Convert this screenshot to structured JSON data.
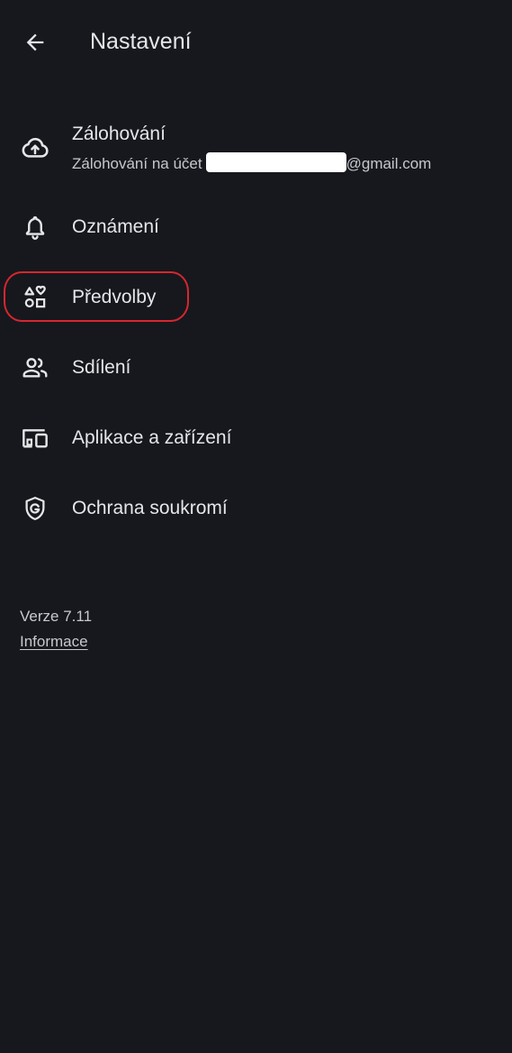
{
  "header": {
    "title": "Nastavení",
    "back_icon": "arrow-back-icon"
  },
  "menu": {
    "items": [
      {
        "id": "backup",
        "label": "Zálohování",
        "subtitle_prefix": "Zálohování na účet",
        "subtitle_suffix": "@gmail.com",
        "icon": "cloud-upload-icon"
      },
      {
        "id": "notifications",
        "label": "Oznámení",
        "icon": "bell-icon"
      },
      {
        "id": "preferences",
        "label": "Předvolby",
        "icon": "shapes-icon",
        "highlighted": true
      },
      {
        "id": "sharing",
        "label": "Sdílení",
        "icon": "people-icon"
      },
      {
        "id": "apps-devices",
        "label": "Aplikace a zařízení",
        "icon": "devices-icon"
      },
      {
        "id": "privacy",
        "label": "Ochrana soukromí",
        "icon": "shield-g-icon"
      }
    ]
  },
  "footer": {
    "version": "Verze 7.11",
    "info_link": "Informace"
  },
  "colors": {
    "background": "#16181d",
    "text": "#e6e6e9",
    "highlight_ring": "#d8262f"
  }
}
